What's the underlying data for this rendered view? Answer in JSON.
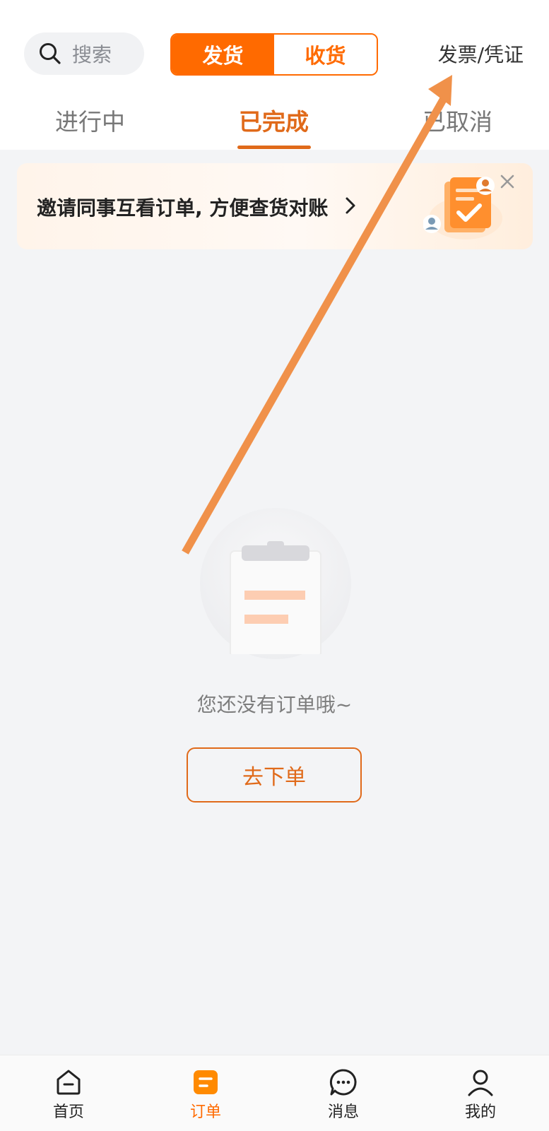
{
  "header": {
    "search_placeholder": "搜索",
    "segment": {
      "ship": "发货",
      "receive": "收货",
      "active": "发货"
    },
    "invoice_link": "发票/凭证"
  },
  "tabs": [
    {
      "label": "进行中"
    },
    {
      "label": "已完成",
      "active": true
    },
    {
      "label": "已取消"
    }
  ],
  "banner": {
    "text": "邀请同事互看订单, 方便查货对账"
  },
  "empty": {
    "message": "您还没有订单哦~",
    "button": "去下单"
  },
  "nav": [
    {
      "label": "首页",
      "icon": "home-icon"
    },
    {
      "label": "订单",
      "icon": "order-icon",
      "active": true
    },
    {
      "label": "消息",
      "icon": "message-icon"
    },
    {
      "label": "我的",
      "icon": "profile-icon"
    }
  ],
  "colors": {
    "accent": "#ff6a00",
    "tab_active": "#e06a1a",
    "annotation_arrow": "#f0914a"
  }
}
